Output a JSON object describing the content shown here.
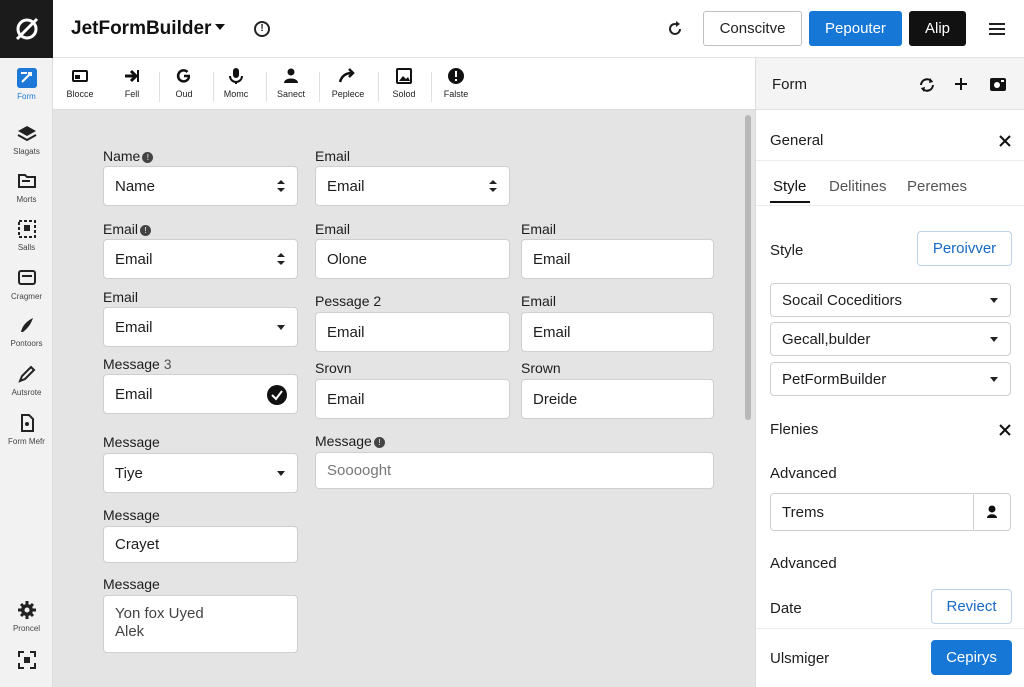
{
  "topbar": {
    "app_title": "JetFormBuilder",
    "buttons": {
      "conscitve": "Conscitve",
      "pepouter": "Pepouter",
      "alip": "Alip"
    }
  },
  "rail": {
    "items": [
      {
        "label": "Form",
        "icon": "form-icon"
      },
      {
        "label": "Slagats",
        "icon": "layers-icon"
      },
      {
        "label": "Morts",
        "icon": "folder-icon"
      },
      {
        "label": "Salls",
        "icon": "select-icon"
      },
      {
        "label": "Cragmer",
        "icon": "card-icon"
      },
      {
        "label": "Pontoors",
        "icon": "brush-icon"
      },
      {
        "label": "Autsrote",
        "icon": "pen-icon"
      },
      {
        "label": "Form Mefr",
        "icon": "document-icon"
      },
      {
        "label": "Proncel",
        "icon": "gear-icon"
      },
      {
        "label": "",
        "icon": "scan-icon"
      }
    ]
  },
  "toolbar": {
    "tools": [
      {
        "label": "Blocce",
        "icon": "block-icon"
      },
      {
        "label": "Fell",
        "icon": "arrow-icon"
      },
      {
        "label": "Oud",
        "icon": "refresh-icon"
      },
      {
        "label": "Momc",
        "icon": "mic-icon"
      },
      {
        "label": "Sanect",
        "icon": "user-icon"
      },
      {
        "label": "Peplece",
        "icon": "share-icon"
      },
      {
        "label": "Solod",
        "icon": "image-icon"
      },
      {
        "label": "Falste",
        "icon": "info-icon"
      }
    ]
  },
  "form": {
    "col1": [
      {
        "label": "Name",
        "suffix": "●",
        "value": "Name",
        "control": "updown"
      },
      {
        "label": "Email",
        "suffix": "●",
        "value": "Email",
        "control": "updown"
      },
      {
        "label": "Email",
        "suffix": "",
        "value": "Email",
        "control": "dropdown"
      },
      {
        "label": "Message",
        "suffix": "3",
        "value": "Email",
        "control": "check"
      },
      {
        "label": "Message",
        "suffix": "",
        "value": "Tiye",
        "control": "dropdown"
      },
      {
        "label": "Message",
        "suffix": "",
        "value": "Crayet",
        "control": "none"
      },
      {
        "label": "Message",
        "suffix": "",
        "value_lines": [
          "Yon fox Uyed",
          "Alek"
        ],
        "control": "textarea"
      }
    ],
    "col2": [
      {
        "label": "Email",
        "value": "Email",
        "control": "updown"
      },
      {
        "label": "Email",
        "value": "Olone"
      },
      {
        "label": "Pessage 2",
        "value": "Email"
      },
      {
        "label": "Srovn",
        "value": "Email"
      }
    ],
    "col3": [
      {
        "label": "Email",
        "value": "Email"
      },
      {
        "label": "Email",
        "value": "Email"
      },
      {
        "label": "Srown",
        "value": "Dreide"
      }
    ],
    "wide": {
      "label": "Message",
      "suffix": "●",
      "placeholder": "Sooooght"
    }
  },
  "panel": {
    "header_title": "Form",
    "section_title": "General",
    "tabs": [
      "Style",
      "Delitines",
      "Peremes"
    ],
    "style_label": "Style",
    "style_button": "Peroivver",
    "selects": [
      "Socail Coceditiors",
      "Gecall,bulder",
      "PetFormBuilder"
    ],
    "flenies": "Flenies",
    "advanced1": "Advanced",
    "terms_value": "Trems",
    "advanced2": "Advanced",
    "date_label": "Date",
    "date_button": "Reviect",
    "footer_label": "Ulsmiger",
    "footer_button": "Cepirys"
  },
  "colors": {
    "accent": "#1677d6",
    "dark": "#111111",
    "canvas": "#e4e4e4"
  }
}
